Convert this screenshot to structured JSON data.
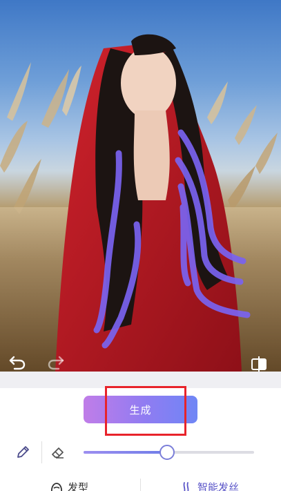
{
  "canvas": {
    "image_description_icon": "portrait-photo",
    "stroke_color": "#7a63f0"
  },
  "toolbar": {
    "undo_icon": "undo-icon",
    "redo_icon": "redo-icon",
    "compare_icon": "compare-icon"
  },
  "panel": {
    "generate_label": "生成",
    "highlight_color": "#e8232b",
    "brush_size": 0.49,
    "tabs": [
      {
        "label": "发型",
        "icon": "hairstyle-icon",
        "active": false
      },
      {
        "label": "智能发丝",
        "icon": "smart-hair-icon",
        "active": true
      }
    ]
  },
  "colors": {
    "accent": "#7b7ed9",
    "generate_gradient_start": "#c07de8",
    "generate_gradient_end": "#6f86f5"
  }
}
